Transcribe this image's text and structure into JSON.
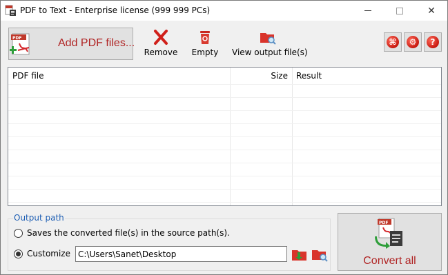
{
  "window": {
    "title": "PDF to Text - Enterprise license (999 999 PCs)"
  },
  "toolbar": {
    "add_pdf_label": "Add PDF files...",
    "remove_label": "Remove",
    "empty_label": "Empty",
    "view_output_label": "View output file(s)"
  },
  "file_list": {
    "columns": [
      "PDF file",
      "Size",
      "Result"
    ],
    "rows": []
  },
  "output_path": {
    "group_title": "Output path",
    "option_source_label": "Saves the converted file(s) in the source path(s).",
    "option_custom_label": "Customize",
    "selected_option": "Customize",
    "custom_path_value": "C:\\Users\\Sanet\\Desktop"
  },
  "convert": {
    "label": "Convert all"
  },
  "icons": {
    "app": "pdf-app-icon",
    "add_pdf": "pdf-add-icon",
    "remove": "red-x-icon",
    "empty": "trash-icon",
    "view_output": "folder-magnifier-icon",
    "web": "globe-icon",
    "settings": "wrench-icon",
    "help": "question-icon",
    "browse": "folder-arrow-icon",
    "open_folder": "folder-magnifier-icon",
    "convert": "pdf-convert-icon"
  },
  "colors": {
    "accent_red": "#b02424",
    "group_title_blue": "#1f5fb4"
  }
}
